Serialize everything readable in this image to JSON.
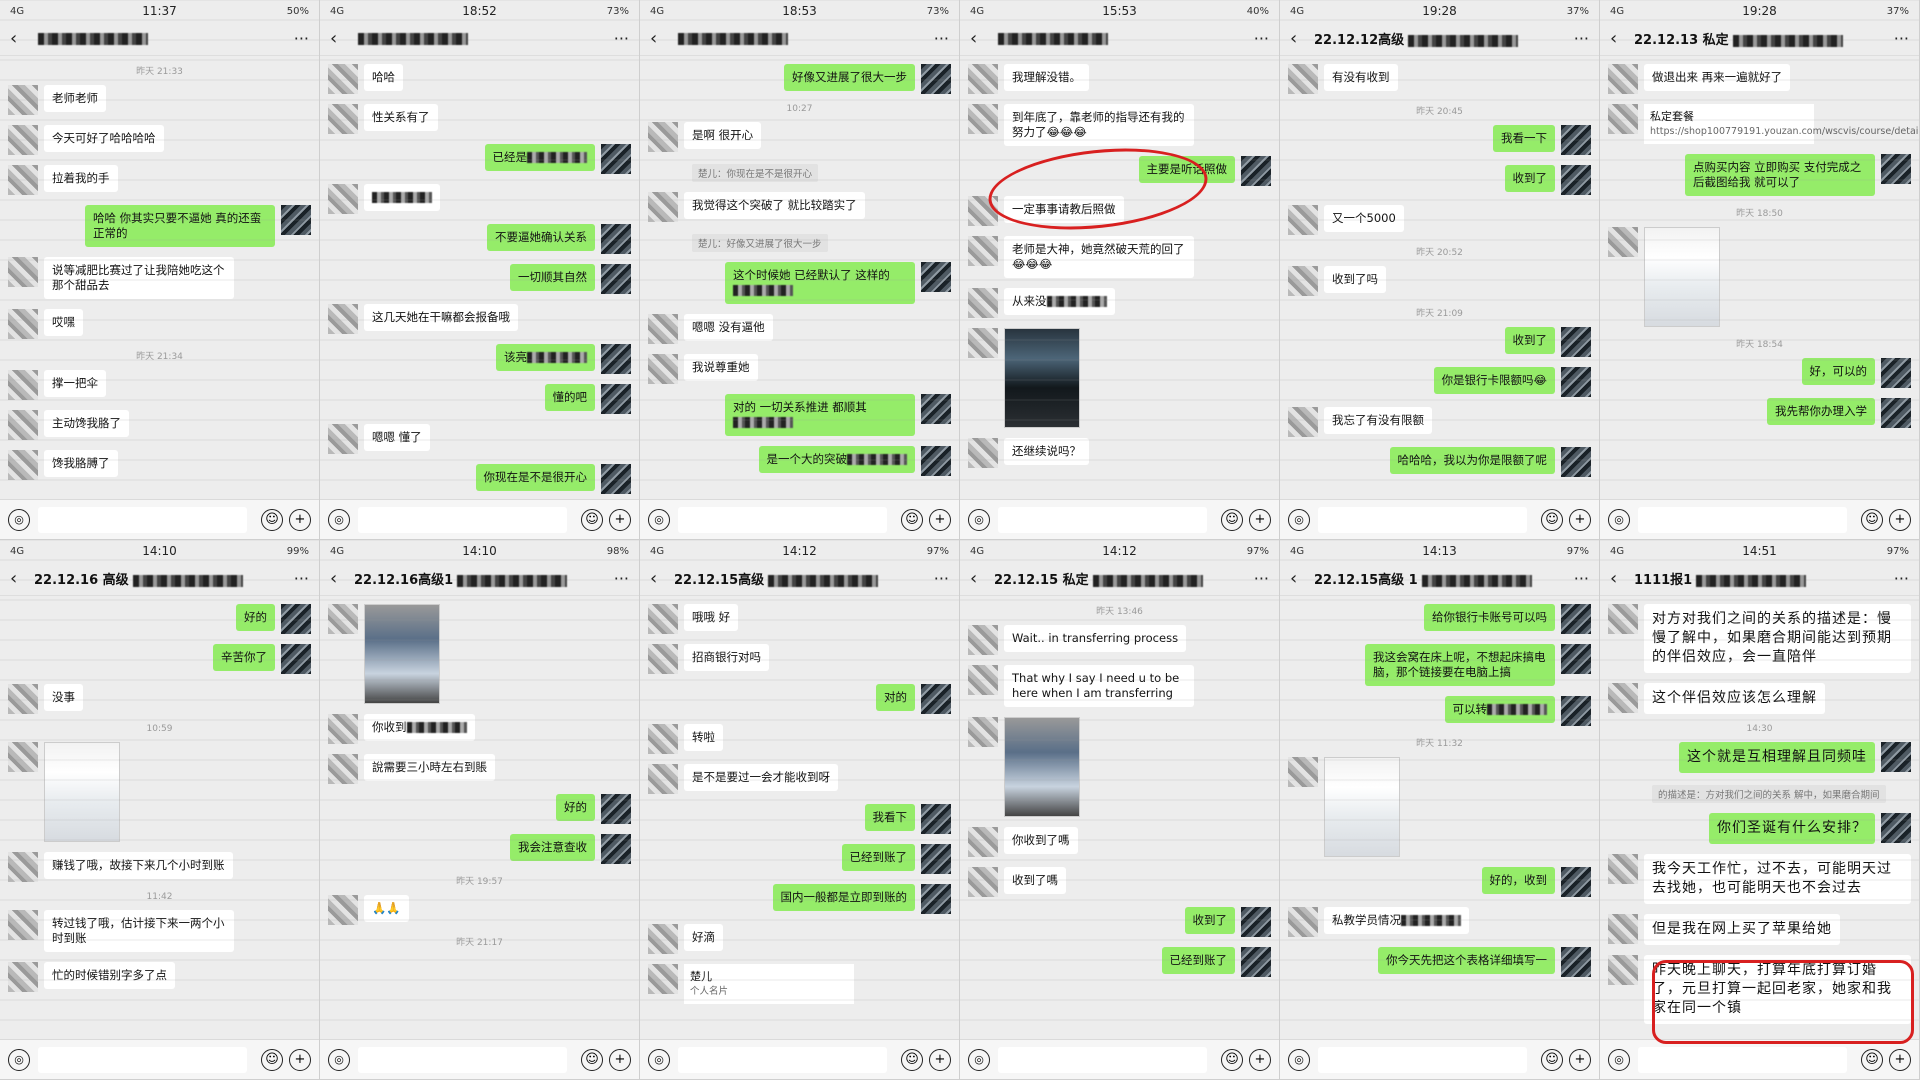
{
  "panels": [
    {
      "status": {
        "left": "4G",
        "time": "11:37",
        "right": "50%"
      },
      "title": "",
      "messages": [
        {
          "type": "time",
          "text": "昨天 21:33"
        },
        {
          "type": "in",
          "text": "老师老师"
        },
        {
          "type": "in",
          "text": "今天可好了哈哈哈哈"
        },
        {
          "type": "in",
          "text": "拉着我的手"
        },
        {
          "type": "out",
          "text": "哈哈 你其实只要不逼她 真的还蛮正常的"
        },
        {
          "type": "in",
          "text": "说等减肥比赛过了让我陪她吃这个那个甜品去"
        },
        {
          "type": "in",
          "text": "哎嘿"
        },
        {
          "type": "time",
          "text": "昨天 21:34"
        },
        {
          "type": "in",
          "text": "撑一把伞"
        },
        {
          "type": "in",
          "text": "主动馋我胳了"
        },
        {
          "type": "in",
          "text": "馋我胳膊了"
        }
      ]
    },
    {
      "status": {
        "left": "4G",
        "time": "18:52",
        "right": "73%"
      },
      "title": "",
      "messages": [
        {
          "type": "in",
          "text": "哈哈"
        },
        {
          "type": "in",
          "text": "性关系有了"
        },
        {
          "type": "out",
          "text": "已经是",
          "masked": true
        },
        {
          "type": "in",
          "text": "",
          "masked": true
        },
        {
          "type": "out",
          "text": "不要逼她确认关系"
        },
        {
          "type": "out",
          "text": "一切顺其自然"
        },
        {
          "type": "in",
          "text": "这几天她在干嘛都会报备哦"
        },
        {
          "type": "out",
          "text": "该亮",
          "masked": true
        },
        {
          "type": "out",
          "text": "懂的吧"
        },
        {
          "type": "in",
          "text": "嗯嗯 懂了"
        },
        {
          "type": "out",
          "text": "你现在是不是很开心"
        }
      ]
    },
    {
      "status": {
        "left": "4G",
        "time": "18:53",
        "right": "73%"
      },
      "title": "",
      "messages": [
        {
          "type": "out",
          "text": "好像又进展了很大一步"
        },
        {
          "type": "time",
          "text": "10:27"
        },
        {
          "type": "in",
          "text": "是啊 很开心"
        },
        {
          "type": "quote",
          "text": "楚儿：你现在是不是很开心"
        },
        {
          "type": "in",
          "text": "我觉得这个突破了 就比较踏实了"
        },
        {
          "type": "quote",
          "text": "楚儿：好像又进展了很大一步"
        },
        {
          "type": "out",
          "text": "这个时候她 已经默认了 这样的",
          "masked": true
        },
        {
          "type": "in",
          "text": "嗯嗯 没有逼他"
        },
        {
          "type": "in",
          "text": "我说尊重她"
        },
        {
          "type": "out",
          "text": "对的 一切关系推进 都顺其",
          "masked": true
        },
        {
          "type": "out",
          "text": "是一个大的突破",
          "masked": true
        }
      ]
    },
    {
      "status": {
        "left": "4G",
        "time": "15:53",
        "right": "40%"
      },
      "title": "",
      "messages": [
        {
          "type": "in",
          "text": "我理解没错。"
        },
        {
          "type": "in",
          "text": "到年底了，靠老师的指导还有我的努力了😂😂😂"
        },
        {
          "type": "out",
          "text": "主要是听话照做"
        },
        {
          "type": "in",
          "text": "一定事事请教后照做"
        },
        {
          "type": "in",
          "text": "老师是大神，她竟然破天荒的回了😂😂😂"
        },
        {
          "type": "in",
          "text": "从来没",
          "masked": true
        },
        {
          "type": "photo",
          "kind": "dark"
        },
        {
          "type": "in",
          "text": "还继续说吗？"
        }
      ]
    },
    {
      "status": {
        "left": "4G",
        "time": "19:28",
        "right": "37%"
      },
      "title": "22.12.12高级",
      "messages": [
        {
          "type": "in",
          "text": "有没有收到"
        },
        {
          "type": "time",
          "text": "昨天 20:45"
        },
        {
          "type": "out",
          "text": "我看一下"
        },
        {
          "type": "out",
          "text": "收到了"
        },
        {
          "type": "in",
          "text": "又一个5000"
        },
        {
          "type": "time",
          "text": "昨天 20:52"
        },
        {
          "type": "in",
          "text": "收到了吗"
        },
        {
          "type": "time",
          "text": "昨天 21:09"
        },
        {
          "type": "out",
          "text": "收到了"
        },
        {
          "type": "out",
          "text": "你是银行卡限额吗😂"
        },
        {
          "type": "in",
          "text": "我忘了有没有限额"
        },
        {
          "type": "out",
          "text": "哈哈哈，我以为你是限额了呢"
        }
      ]
    },
    {
      "status": {
        "left": "4G",
        "time": "19:28",
        "right": "37%"
      },
      "title": "22.12.13 私定",
      "messages": [
        {
          "type": "in",
          "text": "做退出来 再来一遍就好了"
        },
        {
          "type": "card",
          "title": "私定套餐",
          "url": "https://shop100779191.youzan.com/wscvis/course/detail/3evsadaczguf3nv?..."
        },
        {
          "type": "out",
          "text": "点购买内容 立即购买 支付完成之后截图给我 就可以了"
        },
        {
          "type": "time",
          "text": "昨天 18:50"
        },
        {
          "type": "photo",
          "kind": "doc"
        },
        {
          "type": "time",
          "text": "昨天 18:54"
        },
        {
          "type": "out",
          "text": "好，可以的"
        },
        {
          "type": "out",
          "text": "我先帮你办理入学"
        }
      ]
    },
    {
      "status": {
        "left": "4G",
        "time": "14:10",
        "right": "99%"
      },
      "title": "22.12.16 高级",
      "messages": [
        {
          "type": "out",
          "text": "好的"
        },
        {
          "type": "out",
          "text": "辛苦你了"
        },
        {
          "type": "in",
          "text": "没事"
        },
        {
          "type": "time",
          "text": "10:59"
        },
        {
          "type": "photo",
          "kind": "doc"
        },
        {
          "type": "in",
          "text": "赚钱了哦，故接下来几个小时到账"
        },
        {
          "type": "time",
          "text": "11:42"
        },
        {
          "type": "in",
          "text": "转过钱了哦，估计接下来一两个小时到账"
        },
        {
          "type": "in",
          "text": "忙的时候错别字多了点"
        }
      ]
    },
    {
      "status": {
        "left": "4G",
        "time": "14:10",
        "right": "98%"
      },
      "title": "22.12.16高级1",
      "messages": [
        {
          "type": "photo",
          "kind": "phone"
        },
        {
          "type": "in",
          "text": "你收到",
          "masked": true
        },
        {
          "type": "in",
          "text": "說需要三小時左右到賬"
        },
        {
          "type": "out",
          "text": "好的"
        },
        {
          "type": "out",
          "text": "我会注意查收"
        },
        {
          "type": "time",
          "text": "昨天 19:57"
        },
        {
          "type": "in",
          "text": "🙏🙏"
        },
        {
          "type": "time",
          "text": "昨天 21:17"
        }
      ]
    },
    {
      "status": {
        "left": "4G",
        "time": "14:12",
        "right": "97%"
      },
      "title": "22.12.15高级",
      "messages": [
        {
          "type": "in",
          "text": "哦哦 好"
        },
        {
          "type": "in",
          "text": "招商银行对吗"
        },
        {
          "type": "out",
          "text": "对的"
        },
        {
          "type": "in",
          "text": "转啦"
        },
        {
          "type": "in",
          "text": "是不是要过一会才能收到呀"
        },
        {
          "type": "out",
          "text": "我看下"
        },
        {
          "type": "out",
          "text": "已经到账了"
        },
        {
          "type": "out",
          "text": "国内一般都是立即到账的"
        },
        {
          "type": "in",
          "text": "好滴"
        },
        {
          "type": "card",
          "title": "楚儿",
          "url": "个人名片"
        }
      ]
    },
    {
      "status": {
        "left": "4G",
        "time": "14:12",
        "right": "97%"
      },
      "title": "22.12.15 私定",
      "messages": [
        {
          "type": "time",
          "text": "昨天 13:46"
        },
        {
          "type": "in",
          "text": "Wait.. in transferring process"
        },
        {
          "type": "in",
          "text": "That why I say I need u to be here when I am transferring"
        },
        {
          "type": "photo",
          "kind": "phone"
        },
        {
          "type": "in",
          "text": "你收到了嗎"
        },
        {
          "type": "in",
          "text": "收到了嗎"
        },
        {
          "type": "out",
          "text": "收到了"
        },
        {
          "type": "out",
          "text": "已经到账了"
        }
      ]
    },
    {
      "status": {
        "left": "4G",
        "time": "14:13",
        "right": "97%"
      },
      "title": "22.12.15高级 1",
      "messages": [
        {
          "type": "out",
          "text": "给你银行卡账号可以吗"
        },
        {
          "type": "out",
          "text": "我这会窝在床上呢，不想起床搞电脑，那个链接要在电脑上搞"
        },
        {
          "type": "out",
          "text": "可以转",
          "masked": true
        },
        {
          "type": "time",
          "text": "昨天 11:32"
        },
        {
          "type": "photo",
          "kind": "doc"
        },
        {
          "type": "out",
          "text": "好的，收到"
        },
        {
          "type": "in",
          "text": "私教学员情况",
          "masked": true
        },
        {
          "type": "out",
          "text": "你今天先把这个表格详细填写一"
        }
      ]
    },
    {
      "status": {
        "left": "4G",
        "time": "14:51",
        "right": "97%"
      },
      "title": "1111报1",
      "messages": [
        {
          "type": "in",
          "text": "对方对我们之间的关系的描述是：慢慢了解中，如果磨合期间能达到预期的伴侣效应，会一直陪伴",
          "big": true
        },
        {
          "type": "in",
          "text": "这个伴侣效应该怎么理解",
          "big": true
        },
        {
          "type": "time",
          "text": "14:30"
        },
        {
          "type": "out",
          "text": "这个就是互相理解且同频哇",
          "big": true
        },
        {
          "type": "quote",
          "text": "的描述是：方对我们之间的关系 解中，如果磨合期间"
        },
        {
          "type": "out",
          "text": "你们圣诞有什么安排？",
          "big": true
        },
        {
          "type": "in",
          "text": "我今天工作忙，过不去，可能明天过去找她，也可能明天也不会过去",
          "big": true
        },
        {
          "type": "in",
          "text": "但是我在网上买了苹果给她",
          "big": true
        },
        {
          "type": "in",
          "text": "昨天晚上聊天，打算年底打算订婚了，元旦打算一起回老家，她家和我家在同一个镇",
          "big": true
        }
      ]
    }
  ],
  "bottom_bar": {
    "voice_label": "◎",
    "emoji_label": "☺",
    "plus_label": "+"
  }
}
